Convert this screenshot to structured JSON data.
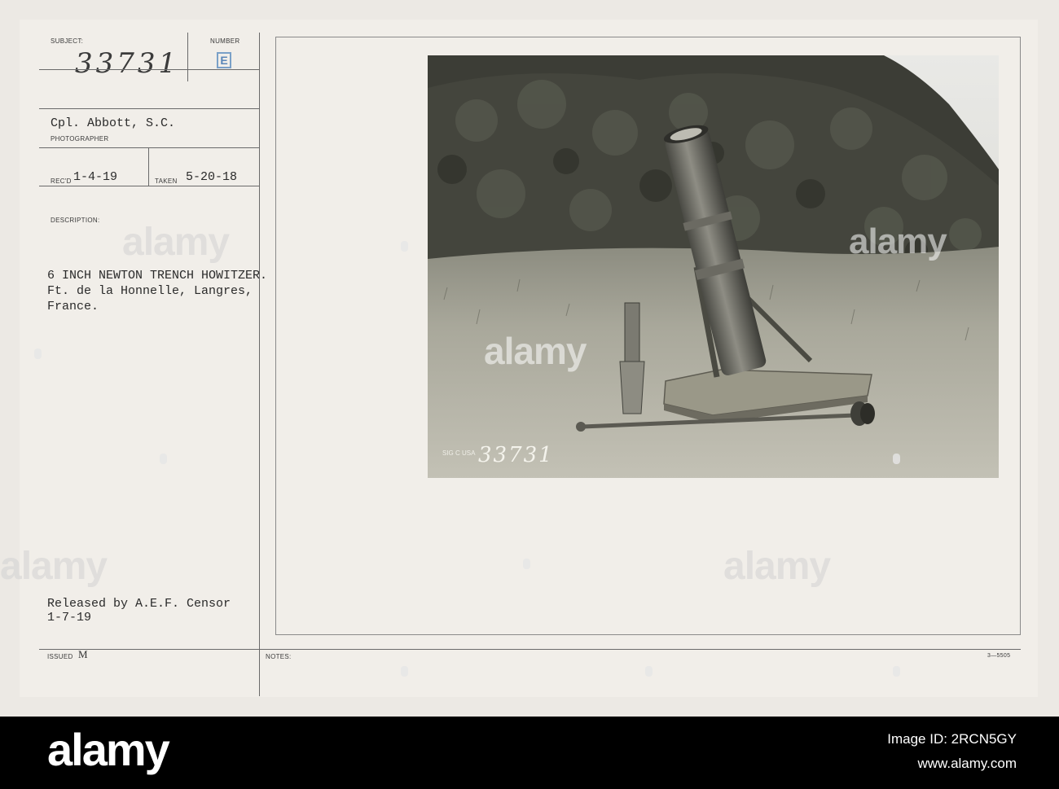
{
  "card": {
    "subject_label": "SUBJECT:",
    "subject_number": "33731",
    "number_label": "NUMBER",
    "number_code": "E",
    "photographer": "Cpl. Abbott, S.C.",
    "photographer_label": "PHOTOGRAPHER",
    "recd_label": "REC'D",
    "recd_date": "1-4-19",
    "taken_label": "TAKEN",
    "taken_date": "5-20-18",
    "description_label": "DESCRIPTION:",
    "description_lines": [
      "6 INCH NEWTON TRENCH HOWITZER.",
      "Ft. de la Honnelle, Langres,",
      "France."
    ],
    "release_lines": [
      "Released by A.E.F. Censor",
      "1-7-19"
    ],
    "issued_label": "ISSUED",
    "issued_code": "M",
    "notes_label": "NOTES:",
    "form_number": "3—5505",
    "photo_stamp": "SIG C USA",
    "photo_number": "33731"
  },
  "watermark": {
    "text": "alamy"
  },
  "footer": {
    "logo": "alamy",
    "image_id_label": "Image ID: 2RCN5GY",
    "site": "www.alamy.com"
  },
  "colors": {
    "card_background": "#f1eee9",
    "footer_background": "#000000"
  }
}
